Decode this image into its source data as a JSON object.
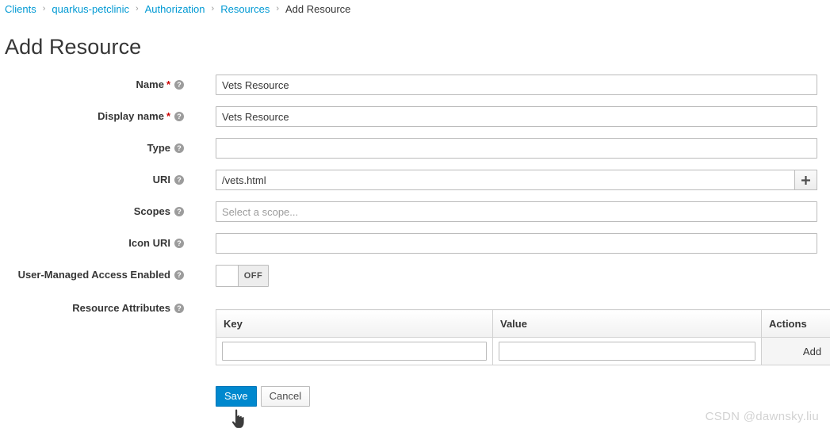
{
  "breadcrumb": {
    "separator": "›",
    "items": [
      {
        "label": "Clients",
        "link": true
      },
      {
        "label": "quarkus-petclinic",
        "link": true
      },
      {
        "label": "Authorization",
        "link": true
      },
      {
        "label": "Resources",
        "link": true
      },
      {
        "label": "Add Resource",
        "link": false
      }
    ]
  },
  "page": {
    "title": "Add Resource"
  },
  "form": {
    "help_icon": "?",
    "required_marker": "*",
    "fields": {
      "name": {
        "label": "Name",
        "value": "Vets Resource",
        "placeholder": ""
      },
      "display_name": {
        "label": "Display name",
        "value": "Vets Resource",
        "placeholder": ""
      },
      "type": {
        "label": "Type",
        "value": "",
        "placeholder": ""
      },
      "uri": {
        "label": "URI",
        "value": "/vets.html",
        "placeholder": "",
        "add_button_icon": "plus-icon"
      },
      "scopes": {
        "label": "Scopes",
        "value": "",
        "placeholder": "Select a scope..."
      },
      "icon_uri": {
        "label": "Icon URI",
        "value": "",
        "placeholder": ""
      },
      "uma_enabled": {
        "label": "User-Managed Access Enabled",
        "state_label": "OFF",
        "state": false
      },
      "resource_attributes": {
        "label": "Resource Attributes"
      }
    }
  },
  "attributes_table": {
    "columns": [
      "Key",
      "Value",
      "Actions"
    ],
    "rows": [
      {
        "key": "",
        "value": "",
        "key_placeholder": "",
        "value_placeholder": "",
        "action_label": "Add"
      }
    ]
  },
  "buttons": {
    "save": "Save",
    "cancel": "Cancel"
  },
  "watermark": {
    "text": "CSDN @dawnsky.liu"
  },
  "colors": {
    "link": "#0099d3",
    "primary": "#0088ce",
    "required": "#cc0000",
    "text": "#363636",
    "muted": "#9c9c9c"
  }
}
